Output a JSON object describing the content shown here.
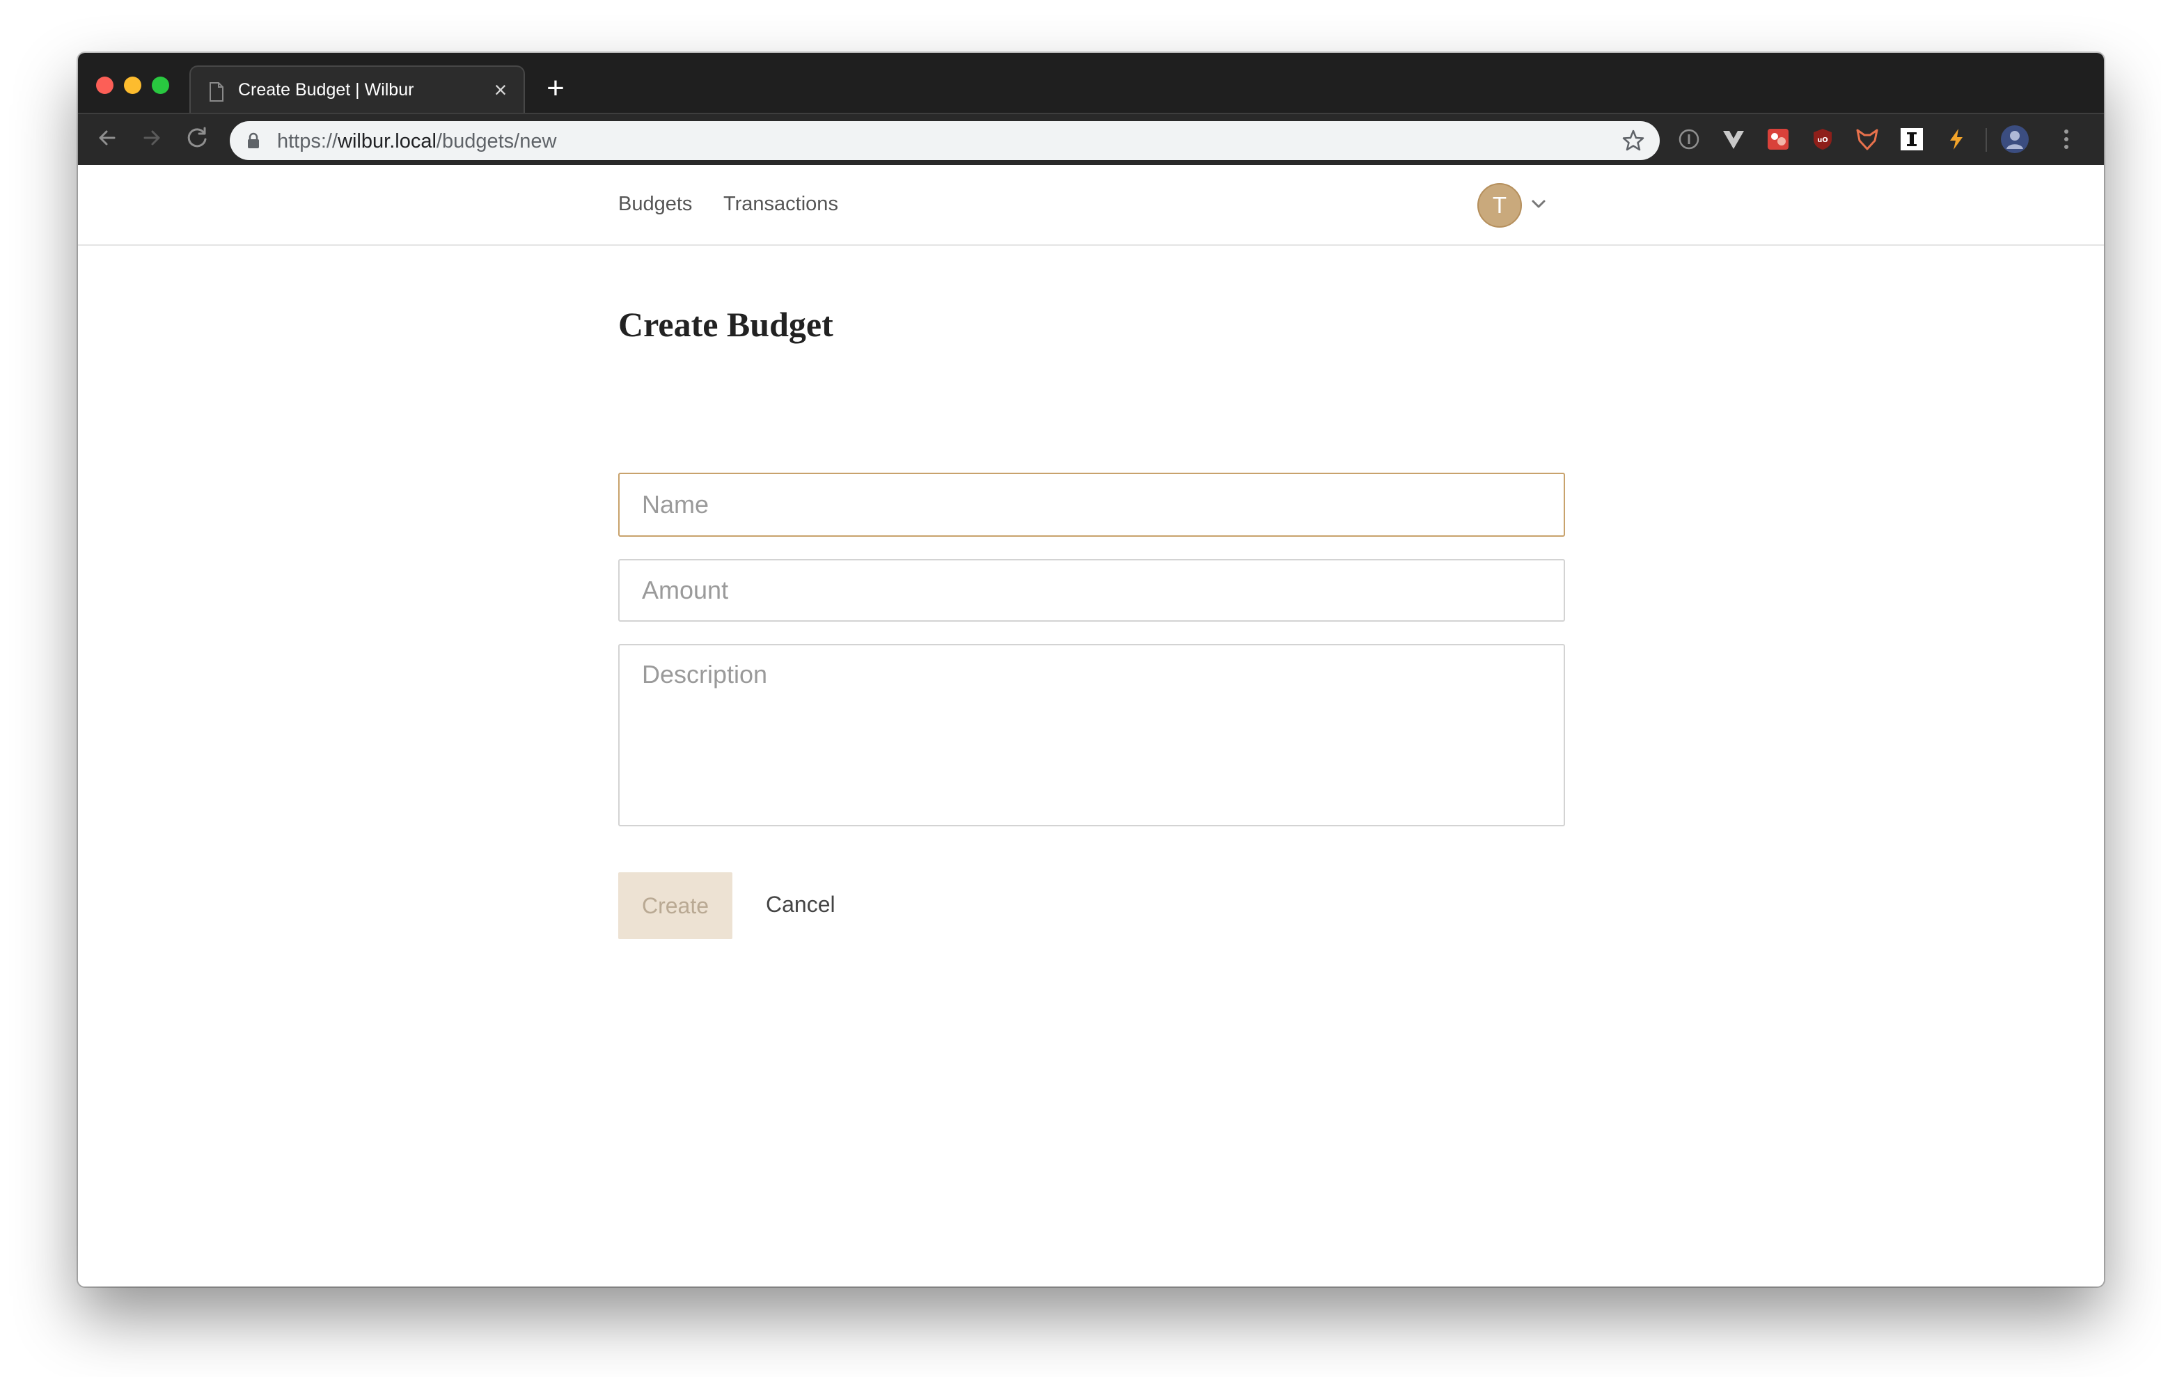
{
  "browser": {
    "tab": {
      "title": "Create Budget | Wilbur",
      "close_glyph": "×"
    },
    "new_tab_glyph": "+",
    "address_bar": {
      "scheme": "https://",
      "host": "wilbur.local",
      "path": "/budgets/new"
    },
    "extensions": [
      "info-icon",
      "vue-devtools-icon",
      "red-extension-icon",
      "ublock-origin-icon",
      "fox-extension-icon",
      "instapaper-icon",
      "lightning-icon"
    ],
    "colors": {
      "titlebar": "#1f1f1f",
      "toolbar": "#292929",
      "close": "#fc5f57",
      "minimize": "#fdbc2e",
      "zoom": "#29c840"
    }
  },
  "app": {
    "nav": {
      "links": [
        "Budgets",
        "Transactions"
      ],
      "user_initial": "T"
    },
    "page_title": "Create Budget",
    "form": {
      "name_placeholder": "Name",
      "amount_placeholder": "Amount",
      "description_placeholder": "Description",
      "create_label": "Create",
      "cancel_label": "Cancel"
    },
    "colors": {
      "accent": "#c9a97c",
      "focus_border": "#c8a26c",
      "create_disabled_bg": "#ede2d3",
      "create_disabled_text": "#b9a993"
    }
  }
}
